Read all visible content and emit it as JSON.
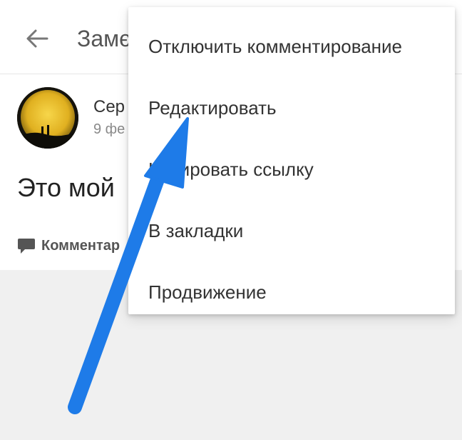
{
  "app_bar": {
    "title": "Замє"
  },
  "post": {
    "author": "Сер",
    "date": "9 фе",
    "text": "Это мой",
    "comments_label": "Комментар"
  },
  "feed": {
    "partial_text": "К"
  },
  "context_menu": {
    "items": [
      {
        "label": "Отключить комментирование"
      },
      {
        "label": "Редактировать"
      },
      {
        "label": "Копировать ссылку"
      },
      {
        "label": "В закладки"
      },
      {
        "label": "Продвижение"
      }
    ]
  },
  "colors": {
    "annotation_arrow": "#1e7be8",
    "menu_bg": "#ffffff",
    "feed_bg": "#f0f0f0"
  },
  "icons": {
    "back": "arrow-left-icon",
    "comments": "speech-bubble-icon"
  }
}
